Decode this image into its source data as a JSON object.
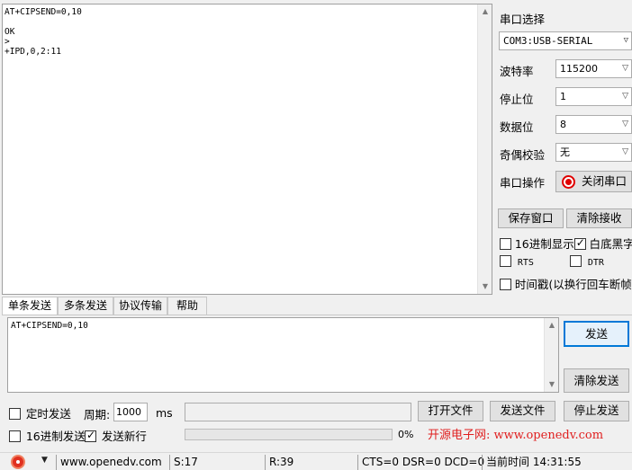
{
  "receive": {
    "lines": [
      "AT+CIPSEND=0,10",
      "",
      "OK",
      ">",
      "+IPD,0,2:11"
    ]
  },
  "serial": {
    "title": "串口选择",
    "port_value": "COM3:USB-SERIAL",
    "baud_label": "波特率",
    "baud_value": "115200",
    "stop_label": "停止位",
    "stop_value": "1",
    "data_label": "数据位",
    "data_value": "8",
    "parity_label": "奇偶校验",
    "parity_value": "无",
    "op_label": "串口操作",
    "close_port_label": "关闭串口",
    "save_window_label": "保存窗口",
    "clear_recv_label": "清除接收",
    "hex_display_label": "16进制显示",
    "white_bg_label": "白底黑字",
    "rts_label": "RTS",
    "dtr_label": "DTR",
    "timestamp_label": "时间戳(以换行回车断帧)"
  },
  "tabs": [
    "单条发送",
    "多条发送",
    "协议传输",
    "帮助"
  ],
  "send": {
    "text": "AT+CIPSEND=0,10",
    "send_label": "发送",
    "clear_send_label": "清除发送"
  },
  "bottom": {
    "timed_send_label": "定时发送",
    "period_label": "周期:",
    "period_value": "1000",
    "period_unit": "ms",
    "open_file_label": "打开文件",
    "send_file_label": "发送文件",
    "stop_send_label": "停止发送",
    "hex_send_label": "16进制发送",
    "newline_label": "发送新行",
    "progress_percent": "0%",
    "brand_text": "开源电子网: www.openedv.com"
  },
  "statusbar": {
    "url": "www.openedv.com",
    "sent": "S:17",
    "received": "R:39",
    "lines": "CTS=0 DSR=0 DCD=0",
    "time": "当前时间 14:31:55"
  },
  "colors": {
    "accent": "#0078d7",
    "record_red": "#e00000",
    "brand_red": "#e02020",
    "brand_blue": "#0000cc"
  }
}
